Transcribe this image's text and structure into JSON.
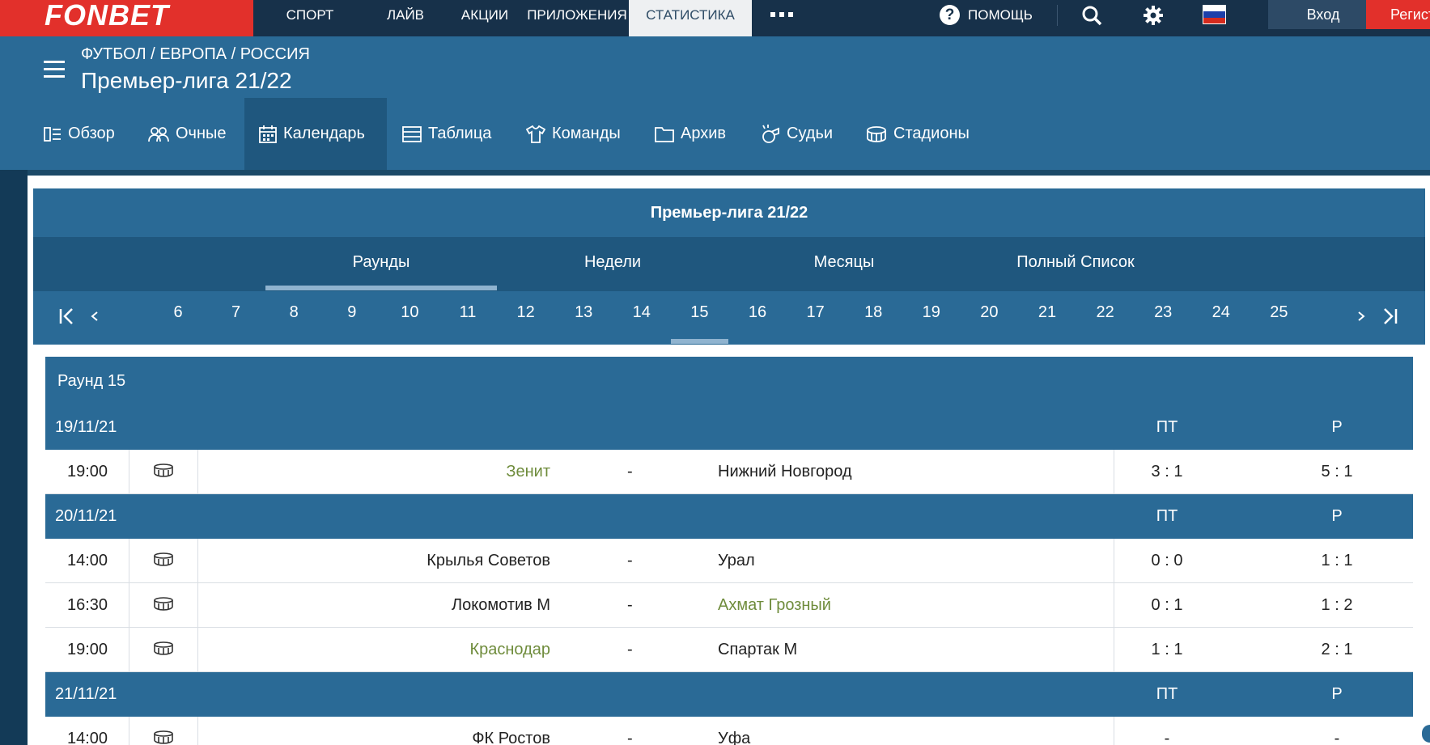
{
  "brand": {
    "logo": "FONBET"
  },
  "top_nav": [
    "СПОРТ",
    "ЛАЙВ",
    "АКЦИИ",
    "ПРИЛОЖЕНИЯ",
    "СТАТИСТИКА"
  ],
  "top_nav_active": "СТАТИСТИКА",
  "help": {
    "label": "ПОМОЩЬ"
  },
  "auth": {
    "login": "Вход",
    "register": "Регистрация"
  },
  "league": {
    "breadcrumb": "ФУТБОЛ / ЕВРОПА / РОССИЯ",
    "title": "Премьер-лига 21/22"
  },
  "league_nav": [
    "Обзор",
    "Очные",
    "Календарь",
    "Таблица",
    "Команды",
    "Архив",
    "Судьи",
    "Стадионы"
  ],
  "league_nav_active": "Календарь",
  "calendar": {
    "title": "Премьер-лига 21/22",
    "tabs": [
      "Раунды",
      "Недели",
      "Месяцы",
      "Полный Список"
    ],
    "active_tab": "Раунды",
    "rounds": [
      "6",
      "7",
      "8",
      "9",
      "10",
      "11",
      "12",
      "13",
      "14",
      "15",
      "16",
      "17",
      "18",
      "19",
      "20",
      "21",
      "22",
      "23",
      "24",
      "25"
    ],
    "active_round": "15"
  },
  "round": {
    "title": "Раунд 15",
    "col_ht": "ПТ",
    "col_ft": "Р",
    "days": [
      {
        "date": "19/11/21",
        "matches": [
          {
            "time": "19:00",
            "home": "Зенит",
            "dash": "-",
            "away": "Нижний Новгород",
            "ht": "3 : 1",
            "ft": "5 : 1",
            "winner": "home"
          }
        ]
      },
      {
        "date": "20/11/21",
        "matches": [
          {
            "time": "14:00",
            "home": "Крылья Советов",
            "dash": "-",
            "away": "Урал",
            "ht": "0 : 0",
            "ft": "1 : 1",
            "winner": "none"
          },
          {
            "time": "16:30",
            "home": "Локомотив М",
            "dash": "-",
            "away": "Ахмат Грозный",
            "ht": "0 : 1",
            "ft": "1 : 2",
            "winner": "away"
          },
          {
            "time": "19:00",
            "home": "Краснодар",
            "dash": "-",
            "away": "Спартак М",
            "ht": "1 : 1",
            "ft": "2 : 1",
            "winner": "home"
          }
        ]
      },
      {
        "date": "21/11/21",
        "matches": [
          {
            "time": "14:00",
            "home": "ФК Ростов",
            "dash": "-",
            "away": "Уфа",
            "ht": "-",
            "ft": "-",
            "winner": "none"
          }
        ]
      }
    ]
  },
  "colors": {
    "brand_red": "#e2302b",
    "top_bar": "#17314a",
    "header_blue": "#2a6a96",
    "win_green": "#6f8c3c"
  }
}
